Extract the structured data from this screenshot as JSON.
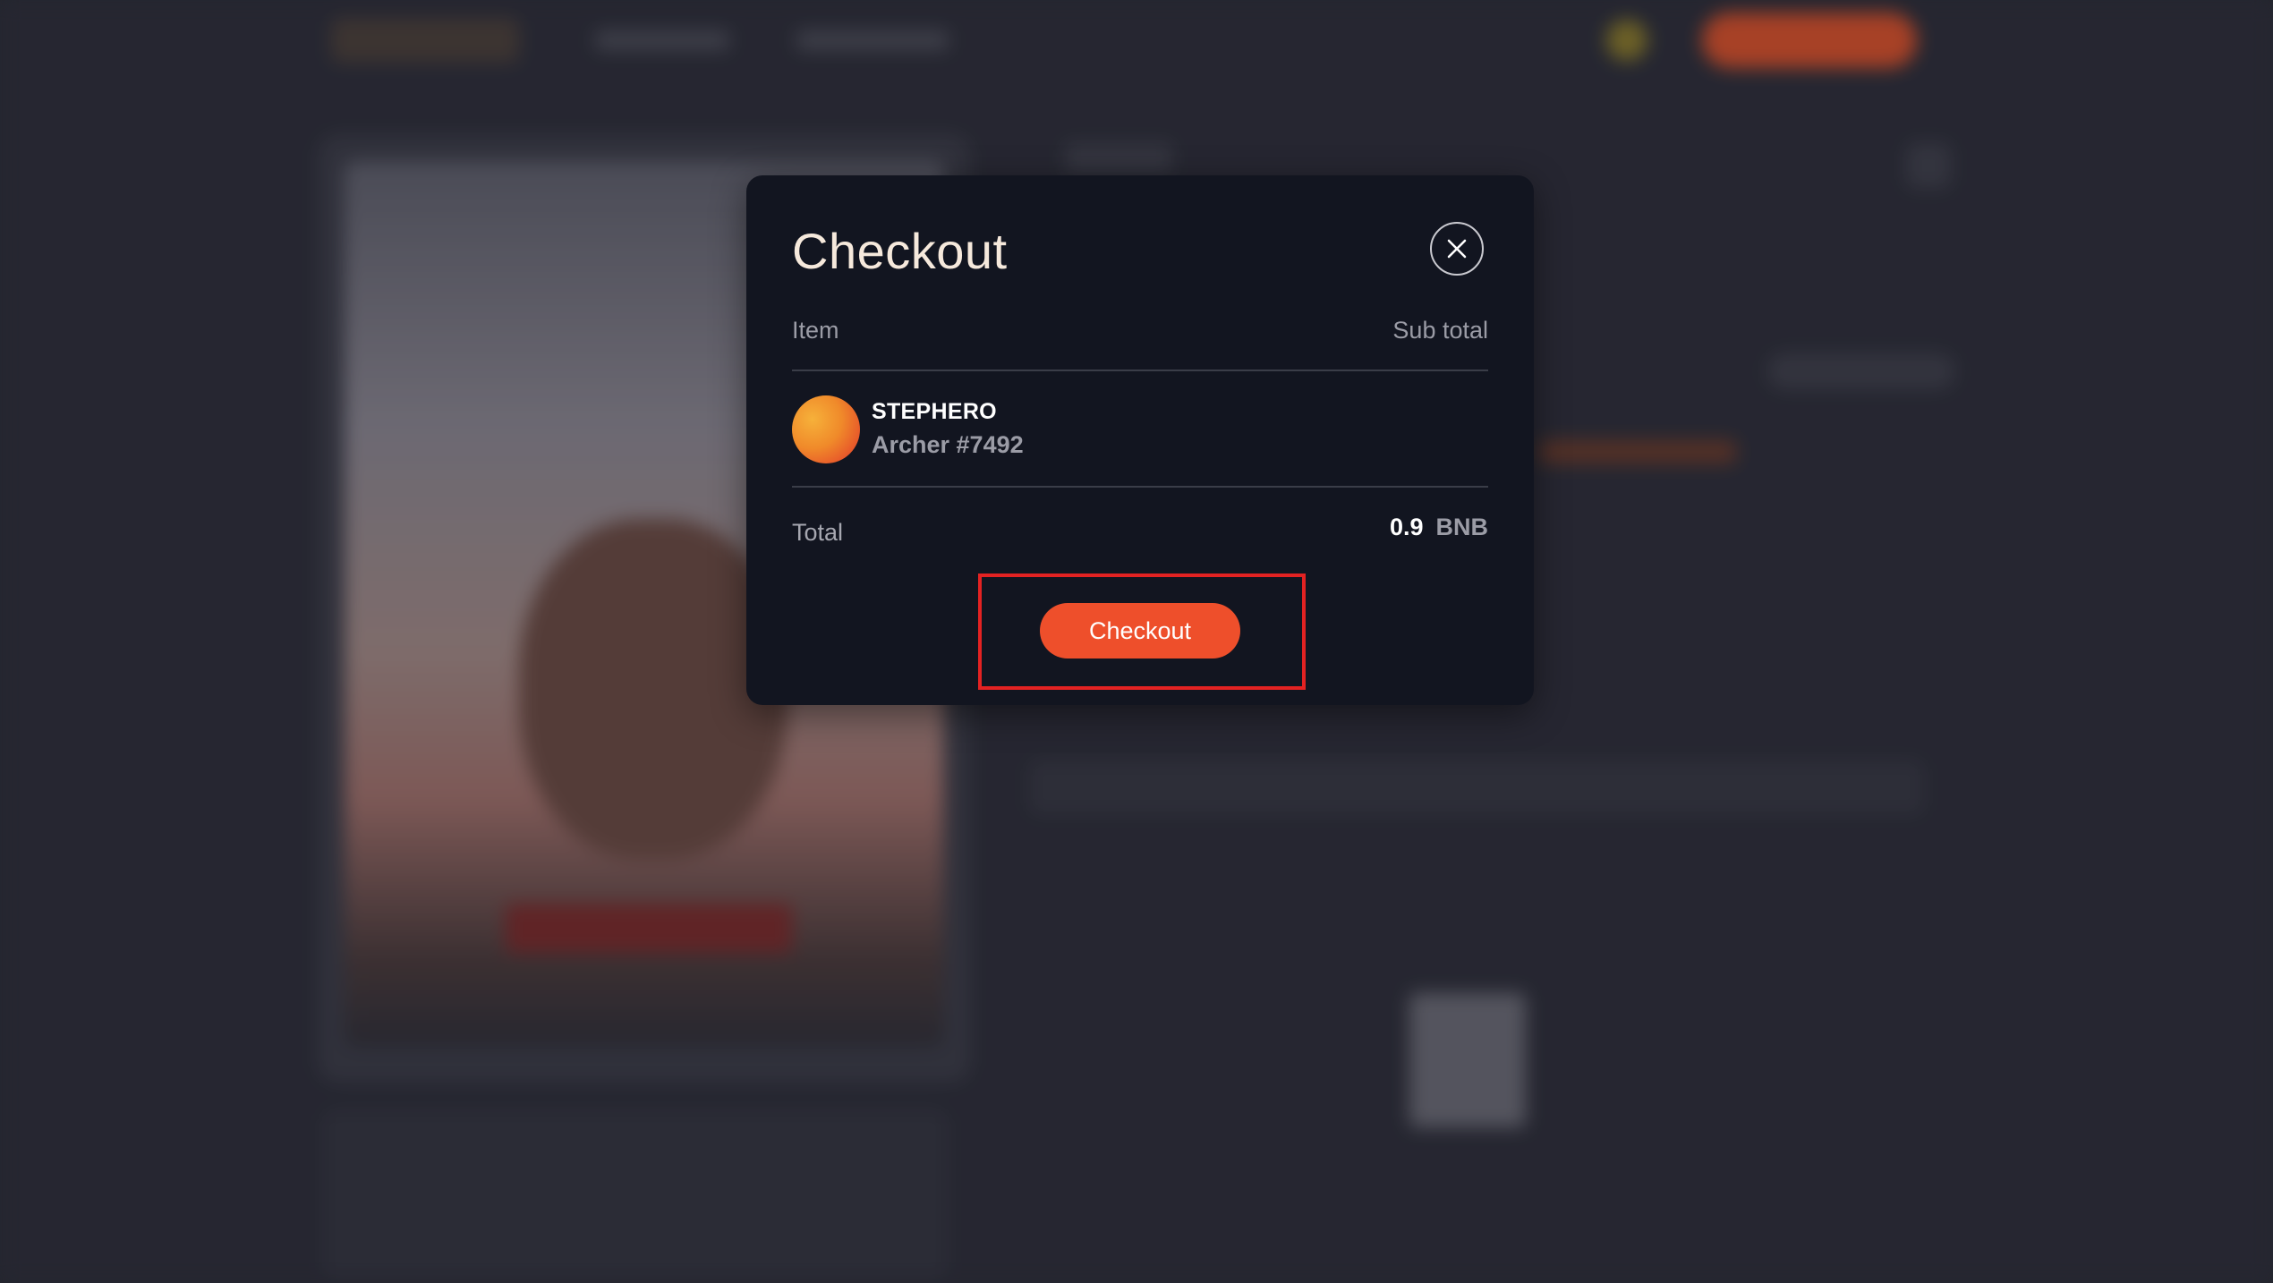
{
  "modal": {
    "title": "Checkout",
    "close_icon": "close-icon",
    "columns": {
      "item": "Item",
      "subtotal": "Sub total"
    },
    "line_item": {
      "collection": "STEPHERO",
      "name": "Archer #7492",
      "avatar_colors": [
        "#f6b13a",
        "#e2352a"
      ]
    },
    "total": {
      "label": "Total",
      "amount": "0.9",
      "currency": "BNB"
    },
    "checkout_label": "Checkout"
  },
  "colors": {
    "accent": "#ee4f2b",
    "modal_bg": "#121520",
    "highlight": "#e32222"
  }
}
